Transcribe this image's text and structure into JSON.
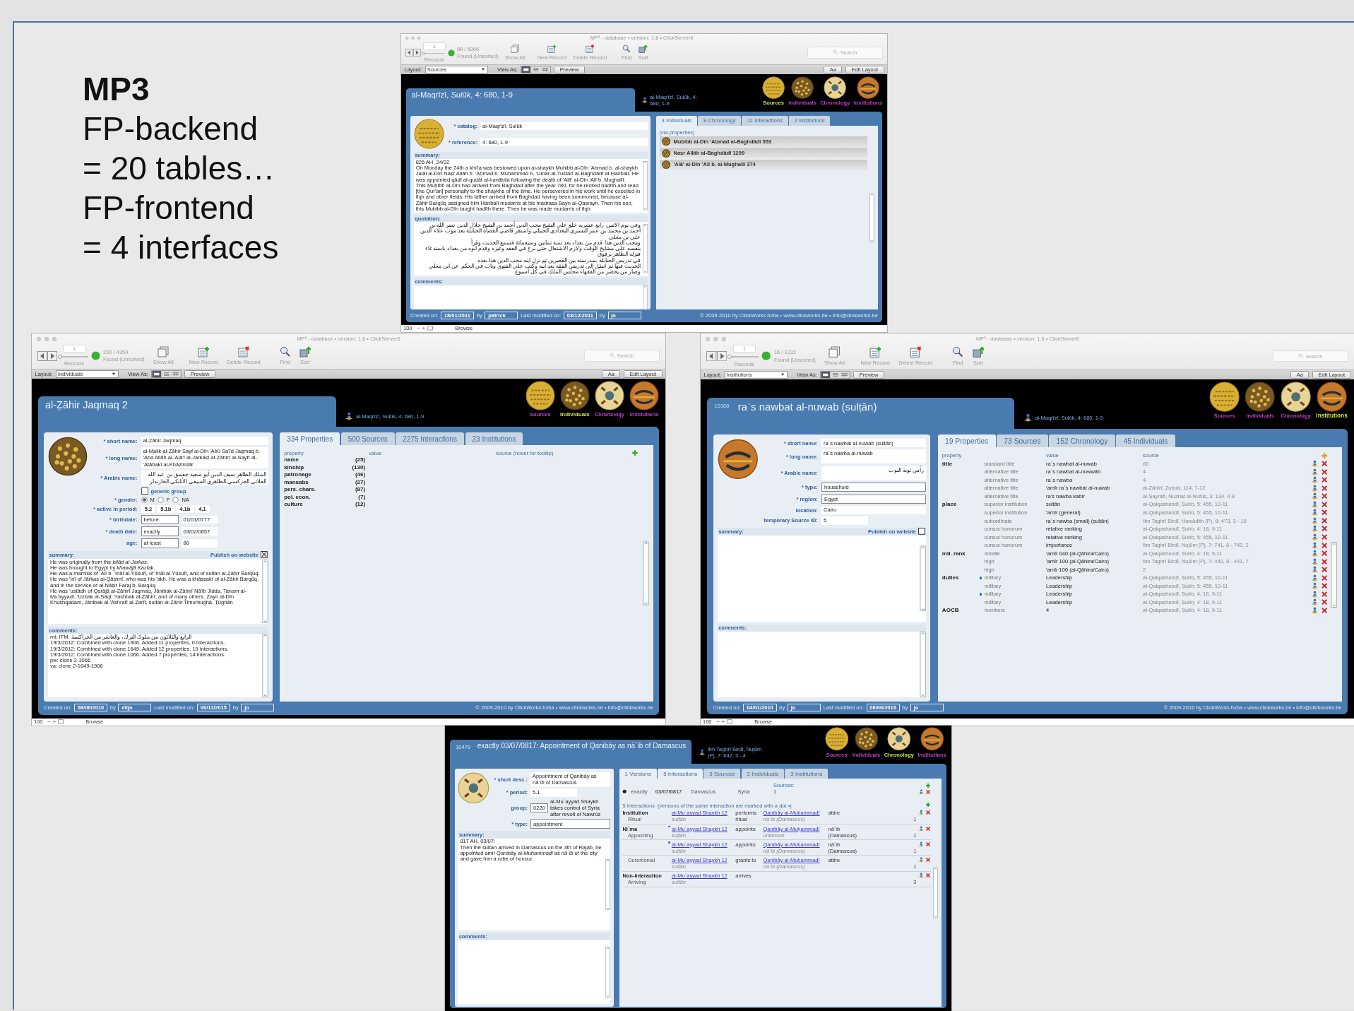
{
  "slide": {
    "heading": "MP3",
    "lines": [
      "FP-backend",
      "= 20 tables…",
      "FP-frontend",
      "= 4 interfaces"
    ]
  },
  "windows": [
    {
      "toolbar": {
        "title": "MP³ - database • version: 1.6 • ClickServer6",
        "record": "1",
        "slider": {
          "level": 0
        },
        "records": "88 / 5066",
        "found": "Found (Unsorted)",
        "records_label": "Records",
        "buttons": [
          {
            "label": "Show All",
            "kind": "show-all"
          },
          {
            "label": "New Record",
            "kind": "new"
          },
          {
            "label": "Delete Record",
            "kind": "delete"
          },
          {
            "label": "Find",
            "kind": "find"
          },
          {
            "label": "Sort",
            "kind": "sort"
          }
        ],
        "search": {
          "placeholder": "Search"
        },
        "layout_label": "Layout:",
        "layout": "Sources",
        "view_label": "View As:",
        "preview": "Preview",
        "font_button": "Aa",
        "edit_layout": "Edit Layout"
      },
      "header": {
        "title": "al-Maqrīzī, *Sulūk*, 4: 680, 1-9",
        "source": "al-Maqrīzī, Sulūk, 4: 680, 1-9",
        "nav": [
          {
            "label": "Sources",
            "selected": true
          },
          {
            "label": "Individuals",
            "selected": false
          },
          {
            "label": "Chronology",
            "selected": false
          },
          {
            "label": "Institutions",
            "selected": false
          }
        ]
      },
      "form": {
        "fields": [
          {
            "kind": "text",
            "label": "* catalog:",
            "value": "al-Maqrīzī, Sulūk"
          },
          {
            "kind": "text",
            "label": "* reference:",
            "value": "4: 680, 1-9"
          }
        ],
        "areas": [
          {
            "kind": "plain",
            "label": "summary:",
            "lines": [
              "826 AH, 24/02",
              "On Monday the 24th a khil'a was bestowed upon al-shaykh Muḥibb al-Dīn 'Aḥmad b. al-shaykh Jalāl al-Dīn Naṣr Allāh b. 'Aḥmad b. Muḥammad b. 'Umar al-Tustarī al-Baghdādī al-Ḥanbalī. He was appointed qāḍī al-quḍāt al-ḥanābila following the death of 'Alā' al-Dīn 'Alī b. Mughallī.",
              "This Muḥibb al-Dīn had arrived from Baghdad after the year 780, for he recited ḥadīth and read [the Qur'an] personally to the shaykhs of the time. He persevered in his work until he excelled in fiqh and other fields. His father arrived from Baghdad having been summoned, because al-Ẓāhir Barqūq assigned him Ḥanbalī mudarris at his madrasa Bayn al-Qaṣrayn. Then his son, this Muḥibb al-Dīn taught ḥadīth there. Then he was made mudarris of fiqh"
            ]
          },
          {
            "kind": "arabic",
            "label": "quotation:",
            "lines": [
              "وفي يوم الاثنين رابع عشريه خلع على الشيخ محب الدين أحمد بن الشيخ جلال الدين نصر الله بن",
              "أحمد بن محمد بن عمر التستري البغدادي الحنبلي واستقر قاضي القضاة الحنابلة بعد موت علاء الدين علي بن مغلي",
              "ومحب الدين هذا قدم من بغداد بعد سنة ثمانين وسبعمائة فسمع الحديث وقرأ",
              "بنفسه على مشايخ الوقت ولازم الاشتغال حتى برع في الفقه وغيره وقدم أبوه من بغداد باستدعاء فنزله الظاهر برقوق",
              "في تدريس الحنابلة بمدرسته بين القصرين ثم نزل ابنه محب الدين هذا بعده",
              "الحديث فيها ثم انتقل إلى تدريس الفقه بعد أبيه وكتب على الفتوى وناب في الحكم عن ابن مغلي",
              "وصار من يحضر من الفقهاء مجلس الملك في كل أسبوع"
            ]
          },
          {
            "kind": "plain",
            "label": "comments:"
          }
        ]
      },
      "tabs": [
        {
          "label": "3 Individuals",
          "selected": true
        },
        {
          "label": "8 Chronology",
          "selected": false
        },
        {
          "label": "11 Interactions",
          "selected": false
        },
        {
          "label": "2 Institutions",
          "selected": false
        }
      ],
      "content": {
        "kind": "linked_list",
        "note": "(via properties)",
        "items": [
          "Muḥibb al-Dīn 'Aḥmad al-Baghdādī 553",
          "Naṣr Allāh al-Baghdādī 1299",
          "'Alā' al-Dīn 'Alī b. al-Mughallī 374"
        ]
      },
      "footer": {
        "created_label": "Created on:",
        "created": "18/01/2011",
        "created_by_label": "by",
        "created_by": "patrick",
        "modified_label": "Last modified on:",
        "modified": "03/12/2011",
        "modified_by_label": "by",
        "modified_by": "jo",
        "copyright": "© 2009-2010 by ClickWorks bvba • www.clickworks.be • info@clickworks.be"
      },
      "status": {
        "zoom": "100",
        "mode": "Browse"
      }
    },
    {
      "toolbar": {
        "title": "MP³ - database • version: 1.6 • ClickServer6",
        "record": "1",
        "slider": {
          "level": 0
        },
        "records": "200 / 4354",
        "found": "Found (Unsorted)",
        "records_label": "Records",
        "buttons": [
          {
            "label": "Show All",
            "kind": "show-all"
          },
          {
            "label": "New Record",
            "kind": "new"
          },
          {
            "label": "Delete Record",
            "kind": "delete"
          },
          {
            "label": "Find",
            "kind": "find"
          },
          {
            "label": "Sort",
            "kind": "sort"
          }
        ],
        "search": {
          "placeholder": "Search"
        },
        "layout_label": "Layout:",
        "layout": "Individuals",
        "view_label": "View As:",
        "preview": "Preview",
        "font_button": "Aa",
        "edit_layout": "Edit Layout"
      },
      "header": {
        "title": "al-Ẓāhir Jaqmaq 2",
        "source": "al-Maqrīzī, Sulūk, 4: 680, 1-9",
        "nav": [
          {
            "label": "Sources",
            "selected": false
          },
          {
            "label": "Individuals",
            "selected": true
          },
          {
            "label": "Chronology",
            "selected": false
          },
          {
            "label": "Institutions",
            "selected": false
          }
        ]
      },
      "form": {
        "fields": [
          {
            "kind": "text",
            "label": "* short name:",
            "value": "al-Ẓāhir Jaqmaq"
          },
          {
            "kind": "multiline",
            "label": "* long name:",
            "value": "al-Malik al-Ẓāhir Sayf al-Dīn 'Abū Sa'īd Jaqmaq b. 'Abd Allāh al-'Alā'ī al-Jarkasī al-Ẓāhirī  al-Sayfī al-'Atābakī al-Khāzindār"
          },
          {
            "kind": "arabic",
            "label": "* Arabic name:",
            "value": "الملك الظاهر سيف الدين أبو سعيد جقمق بن عبد الله العلائي الجركسي الظاهري السيفي الأتابكي الخازندار"
          },
          {
            "kind": "check",
            "label": "generic group",
            "checked": false
          },
          {
            "kind": "radio",
            "label": "* gender:",
            "options": [
              {
                "label": "M",
                "selected": true
              },
              {
                "label": "F",
                "selected": false
              },
              {
                "label": "NA",
                "selected": false
              }
            ]
          },
          {
            "kind": "cells",
            "label": "* active in period:",
            "values": [
              "5.2",
              "5.1b",
              "4.1b",
              "4.1"
            ]
          },
          {
            "kind": "pair",
            "label": "* birthdate:",
            "values": [
              "before",
              "01/01/0777"
            ]
          },
          {
            "kind": "pair",
            "label": "* death date:",
            "values": [
              "exactly",
              "03/02/0857"
            ]
          },
          {
            "kind": "pair",
            "label": "age:",
            "values": [
              "at least",
              "80"
            ]
          }
        ],
        "areas": [
          {
            "kind": "plain",
            "label": "summary:",
            "publish": {
              "label": "Publish on website",
              "checked": true
            },
            "lines": [
              "He was originally from the *bilād al-Jarkas*.",
              "He was brought to Egypt by *khawājā* Kazlak.",
              "He was a mamlūk of 'Alī b. 'Ināl al-Yūsufī, of 'Ināl al-Yūsufī, and of sultan al-Ẓāhir Barqūq. He was 'inī of Jārkas al-Qāsimī, who was his 'akh. He was a khāṣṣakī of al-Ẓāhir Barqūq, and in the service of al-Nāṣir Faraj b. Barqūq.",
              "He was 'ustādh of Qarājā al-Ẓāhirī Jaqmaq, Jānibak al-Ẓāhirī Nā'ib Jidda, Tanam al-Mu'ayyadī, 'Uzbak al-Sāqī, Yashbak al-Ẓāhirī, and of many others. Zayn al-Dīn Khushqadam, Jānibak al-'Ashrafī al-Ẓarīf, sultan al-Ẓāhir Timurbughā, Ṭūghān"
            ]
          },
          {
            "kind": "plain",
            "label": "comments:",
            "lines": [
              "mt: ITM: الرابع والثلاثون من ملوك الترك، والعاشر من الجراكسة",
              "19/3/2012: Combined with clone 1906. Added 11 properties, 0 interactions.",
              "19/3/2012: Combined with clone 1649. Added 12 properties, 19 interactions.",
              "19/3/2012: Combined with clone 1066. Added 7 properties, 14 interactions.",
              "pw: clone 2-1066",
              "va: clone 2-1649-1906"
            ]
          }
        ]
      },
      "tabs": [
        {
          "label": "334 Properties",
          "selected": true
        },
        {
          "label": "500  Sources",
          "selected": false
        },
        {
          "label": "2275  Interactions",
          "selected": false
        },
        {
          "label": "23 Institutions",
          "selected": false
        }
      ],
      "content": {
        "kind": "property_summary",
        "columns": [
          "property",
          "value",
          "source (hover for tooltip)"
        ],
        "groups": [
          {
            "name": "name",
            "count": "(25)"
          },
          {
            "name": "kinship",
            "count": "(130)"
          },
          {
            "name": "patronage",
            "count": "(46)"
          },
          {
            "name": "mansabs",
            "count": "(27)"
          },
          {
            "name": "pers. chars.",
            "count": "(87)"
          },
          {
            "name": "pol. econ.",
            "count": "(7)"
          },
          {
            "name": "culture",
            "count": "(12)"
          }
        ]
      },
      "footer": {
        "created_label": "Created on:",
        "created": "08/06/2010",
        "created_by_label": "by",
        "created_by": "eltjo",
        "modified_label": "Last modified on:",
        "modified": "06/11/2015",
        "modified_by_label": "by",
        "modified_by": "jo",
        "copyright": "© 2009-2010 by ClickWorks bvba • www.clickworks.be • info@clickworks.be"
      },
      "status": {
        "zoom": "100",
        "mode": "Browse"
      }
    },
    {
      "toolbar": {
        "title": "MP³ - database • version: 1.6 • ClickServer6",
        "record": "1",
        "slider": {
          "level": 0
        },
        "records": "16 / 1232",
        "found": "Found (Unsorted)",
        "records_label": "Records",
        "buttons": [
          {
            "label": "Show All",
            "kind": "show-all"
          },
          {
            "label": "New Record",
            "kind": "new"
          },
          {
            "label": "Delete Record",
            "kind": "delete"
          },
          {
            "label": "Find",
            "kind": "find"
          },
          {
            "label": "Sort",
            "kind": "sort"
          }
        ],
        "search": {
          "placeholder": "Search"
        },
        "layout_label": "Layout:",
        "layout": "Institutions",
        "view_label": "View As:",
        "preview": "Preview",
        "font_button": "Aa",
        "edit_layout": "Edit Layout"
      },
      "header": {
        "id": "10100",
        "title": "raʾs nawbat al-nuwab (sulṭān)",
        "source": "al-Maqrīzī, Sulūk, 4: 680, 1-9",
        "nav": [
          {
            "label": "Sources",
            "selected": false
          },
          {
            "label": "Individuals",
            "selected": false
          },
          {
            "label": "Chronology",
            "selected": false
          },
          {
            "label": "Institutions",
            "selected": true
          }
        ]
      },
      "form": {
        "fields": [
          {
            "kind": "text",
            "label": "* short name:",
            "value": "raʾs nawbat al-nuwab (sulṭān)"
          },
          {
            "kind": "multiline",
            "label": "* long name:",
            "value": "raʾs nawba al-nuwab"
          },
          {
            "kind": "arabic",
            "label": "* Arabic name:",
            "value": "رأس نوبة النوب"
          },
          {
            "kind": "boxed",
            "label": "* type:",
            "value": "household"
          },
          {
            "kind": "boxed",
            "label": "* region:",
            "value": "Egypt"
          },
          {
            "kind": "text",
            "label": "location:",
            "value": "Cairo"
          },
          {
            "kind": "short",
            "label": "temporary Source ID:",
            "value": "5"
          }
        ],
        "areas": [
          {
            "kind": "plain",
            "label": "summary:",
            "publish": {
              "label": "Publish on website",
              "checked": false
            }
          },
          {
            "kind": "plain",
            "label": "comments:"
          }
        ]
      },
      "tabs": [
        {
          "label": "19  Properties",
          "selected": true
        },
        {
          "label": "73  Sources",
          "selected": false
        },
        {
          "label": "152  Chronology",
          "selected": false
        },
        {
          "label": "45  Individuals",
          "selected": false
        }
      ],
      "content": {
        "kind": "property_table",
        "columns": [
          "property",
          "value",
          "source"
        ],
        "groups": [
          {
            "name": "title",
            "rows": [
              {
                "type": "standard title",
                "value": "raʾs nawbat al-nuwab",
                "source": "60",
                "dot": false
              },
              {
                "type": "alternative title",
                "value": "raʾs nawbat al-nuwwāb",
                "source": "4",
                "dot": false
              },
              {
                "type": "alternative title",
                "value": "raʾs nawba",
                "source": "4",
                "dot": false
              },
              {
                "type": "alternative title",
                "value": "'amīr raʾs nawbat al-nuwab",
                "source": "al-Ẓāhirī, Zubda, 114, 7-12",
                "dot": false
              },
              {
                "type": "alternative title",
                "value": "ra's nawba kabīr",
                "source": "al-Ṣayrafī, Nuzhat al-Nufūs, 3: 134, 4-8",
                "dot": false
              }
            ]
          },
          {
            "name": "place",
            "rows": [
              {
                "type": "superior institution",
                "value": "sulṭān",
                "source": "al-Qalqashandī, Ṣubḥ, 5: 455, 10-11",
                "dot": false
              },
              {
                "type": "superior institution",
                "value": "'amīr (general)",
                "source": "al-Qalqashandī, Ṣubḥ, 5: 455, 10-11",
                "dot": false
              },
              {
                "type": "subordinate",
                "value": "raʾs nawba (small) (sulṭān)",
                "source": "Ibn Taghrī Birdī, Ḥawādith (P), 8: 473, 3 - 10",
                "dot": false
              },
              {
                "type": "cursus honorum",
                "value": "relative ranking",
                "source": "al-Qalqashandī, Ṣubḥ, 4: 18, 9-11",
                "dot": false
              },
              {
                "type": "cursus honorum",
                "value": "relative ranking",
                "source": "al-Qalqashandī, Ṣubḥ, 5: 455, 10-11",
                "dot": false
              },
              {
                "type": "cursus honorum",
                "value": "importance",
                "source": "Ibn Taghrī Birdī, Nujūm (P), 7: 741, 8 - 742, 2",
                "dot": false
              }
            ]
          },
          {
            "name": "mil. rank",
            "rows": [
              {
                "type": "middle",
                "value": "'amīr 040 (al-Qāhira/Cairo)",
                "source": "al-Qalqashandī, Ṣubḥ, 4: 18, 9-11",
                "dot": false
              },
              {
                "type": "high",
                "value": "'amīr 100 (al-Qāhira/Cairo)",
                "source": "Ibn Taghrī Birdī, Nujūm (P), 7: 440, 8 - 441, 7",
                "dot": false
              },
              {
                "type": "high",
                "value": "'amīr 100 (al-Qāhira/Cairo)",
                "source": "2",
                "dot": false
              }
            ]
          },
          {
            "name": "duties",
            "rows": [
              {
                "type": "military",
                "value": "Leadership",
                "source": "al-Qalqashandī, Ṣubḥ, 5: 455, 10-11",
                "dot": true
              },
              {
                "type": "military",
                "value": "Leadership",
                "source": "al-Qalqashandī, Ṣubḥ, 5: 455, 10-11",
                "dot": false
              },
              {
                "type": "military",
                "value": "Leadership",
                "source": "al-Qalqashandī, Ṣubḥ, 4: 18, 9-11",
                "dot": true
              },
              {
                "type": "military",
                "value": "Leadership",
                "source": "al-Qalqashandī, Ṣubḥ, 4: 18, 9-11",
                "dot": false
              }
            ]
          },
          {
            "name": "AOCB",
            "rows": [
              {
                "type": "numbers",
                "value": "4",
                "source": "al-Qalqashandī, Ṣubḥ, 4: 18, 9-11",
                "dot": false
              }
            ]
          }
        ]
      },
      "footer": {
        "created_label": "Created on:",
        "created": "04/01/2010",
        "created_by_label": "by",
        "created_by": "jo",
        "modified_label": "Last modified on:",
        "modified": "06/06/2016",
        "modified_by_label": "by",
        "modified_by": "jo",
        "copyright": "© 2009-2010 by ClickWorks bvba • www.clickworks.be • info@clickworks.be"
      },
      "status": {
        "zoom": "100",
        "mode": "Browse"
      }
    },
    {
      "header": {
        "id": "10479",
        "title": "exactly 03/07/0817: Appointment of Qanibāy as nāʾib of Damascus",
        "source": "Ibn Taghrī Birdī, Nujūm (P), 7: 642, 3 - 4",
        "nav": [
          {
            "label": "Sources",
            "selected": false
          },
          {
            "label": "Individuals",
            "selected": false
          },
          {
            "label": "Chronology",
            "selected": true
          },
          {
            "label": "Institutions",
            "selected": false
          }
        ]
      },
      "form": {
        "fields": [
          {
            "kind": "multiline",
            "label": "* short desc.:",
            "value": "Appointment of Qanibāy as nāʾib of Damascus"
          },
          {
            "kind": "short",
            "label": "* period:",
            "value": "5.1"
          },
          {
            "kind": "note",
            "label": "group:",
            "value": "0220",
            "note": "al-Muʾayyad Shaykh takes control of Syria after revolt of Nawrūz"
          },
          {
            "kind": "boxed",
            "label": "* type:",
            "value": "appointment"
          }
        ],
        "areas": [
          {
            "kind": "plain",
            "label": "summary:",
            "lines": [
              "817 AH, 03/07:",
              "Then the sultan arrived in Damascus on the 3th of Rajab, he appointed amir Qanibāy al-*Muḥammadī* as *nāʾib* of the city and gave him a robe of honour."
            ]
          },
          {
            "kind": "plain",
            "label": "comments:"
          }
        ]
      },
      "tabs": [
        {
          "label": "1  Versions",
          "selected": true
        },
        {
          "label": "5 Interactions",
          "selected": true
        },
        {
          "label": "3 Sources",
          "selected": false
        },
        {
          "label": "2 Individuals",
          "selected": false
        },
        {
          "label": "3 Institutions",
          "selected": false
        }
      ],
      "content": {
        "kind": "chronology",
        "versions": {
          "sources_label": "Sources:",
          "rows": [
            {
              "selected": true,
              "qualifier": "exactly",
              "date": "03/07/0817",
              "place": "Damascus",
              "region": "Syria",
              "count": "1"
            }
          ]
        },
        "interactions": {
          "title": "5  Interactions",
          "note": "(versions of the same interaction are marked with a dot •)",
          "rows": [
            {
              "category": "Institution",
              "subcategory": "Ritual",
              "dot": false,
              "actor": "al-Muʾayyad Shaykh 12",
              "actor_role": "sulṭān",
              "verb": "performs ritual",
              "target": "Qanibāy al-Muḥammadī",
              "target_role": "nāʾib (Damascus)",
              "object": "attire",
              "count": "1"
            },
            {
              "category": "Niʿma",
              "subcategory": "Appointing",
              "dot": true,
              "actor": "al-Muʾayyad Shaykh 12",
              "actor_role": "sulṭān",
              "verb": "appoints",
              "target": "Qanibāy al-Muḥammadī",
              "target_role": "unknown",
              "object": "nāʾib (Damascus)",
              "count": "1"
            },
            {
              "dot": true,
              "actor": "al-Muʾayyad Shaykh 12",
              "actor_role": "sulṭān",
              "verb": "appoints",
              "target": "Qanibāy al-Muḥammadī",
              "target_role": "nāʾib (Damascus)",
              "object": "nāʾib (Damascus)",
              "count": "1"
            },
            {
              "subcategory": "Ceremonial",
              "dot": false,
              "actor": "al-Muʾayyad Shaykh 12",
              "actor_role": "sulṭān",
              "verb": "grants to",
              "target": "Qanibāy al-Muḥammadī",
              "target_role": "nāʾib (Damascus)",
              "object": "attire",
              "count": "1"
            },
            {
              "category": "Non-interaction",
              "subcategory": "Arriving",
              "dot": false,
              "actor": "al-Muʾayyad Shaykh 12",
              "actor_role": "sulṭān",
              "verb": "arrives",
              "count": "3"
            }
          ]
        }
      }
    }
  ]
}
